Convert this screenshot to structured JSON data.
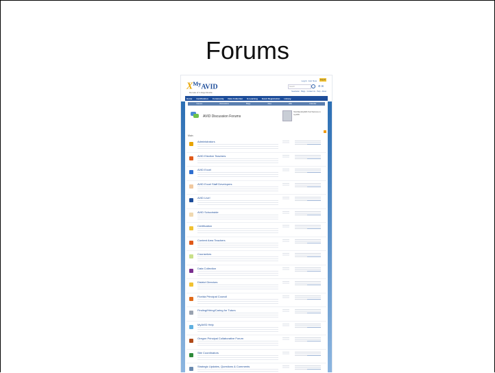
{
  "slide": {
    "title": "Forums"
  },
  "site": {
    "logo_text": "AVID",
    "logo_prefix": "My",
    "logo_tagline": "Decades of College Dreams",
    "top_links": [
      "Log In",
      "Join Now"
    ],
    "login_label": "Log In",
    "search_placeholder": "Search",
    "sub_links": "Newsletter · Blogs · Contact Us · Help · About",
    "nav_items": [
      "Home",
      "Certification",
      "Community",
      "Data Collection",
      "E-Learning",
      "Event Registration",
      "Library"
    ],
    "subnav_items": [
      "Forums",
      "Discussions",
      "Blogs",
      "Files",
      "Wiki",
      "Calendar"
    ],
    "banner_title": "AVID Discussion Forums",
    "user_info": "HelloStandingWith.Test Welcome to myAVID",
    "main_label": "Main",
    "forums": [
      {
        "name": "Administrators",
        "color": "#e8a400"
      },
      {
        "name": "AVID Elective Teachers",
        "color": "#e05a1a"
      },
      {
        "name": "AVID Excel",
        "color": "#2f6fd0"
      },
      {
        "name": "AVID Excel Staff Developers",
        "color": "#f0c9a0"
      },
      {
        "name": "AVID Live!",
        "color": "#1d4d9a"
      },
      {
        "name": "AVID Schoolwide",
        "color": "#f0d9b0"
      },
      {
        "name": "Certification",
        "color": "#f1c232"
      },
      {
        "name": "Content Area Teachers",
        "color": "#e05a1a"
      },
      {
        "name": "Counselors",
        "color": "#c9e08a"
      },
      {
        "name": "Data Collection",
        "color": "#7a2f8f"
      },
      {
        "name": "District Directors",
        "color": "#f1c232"
      },
      {
        "name": "Florida Principal Council",
        "color": "#e06a1a"
      },
      {
        "name": "Finding/Hiring/Caring for Tutors",
        "color": "#9aa3b0"
      },
      {
        "name": "MyAVID Help",
        "color": "#5fb0e0"
      },
      {
        "name": "Oregon Principal Collaborative Forum",
        "color": "#b04a1a"
      },
      {
        "name": "Site Coordinators",
        "color": "#2e8a3a"
      },
      {
        "name": "Strategic Updates, Questions & Comments",
        "color": "#6a8ab0"
      }
    ]
  }
}
